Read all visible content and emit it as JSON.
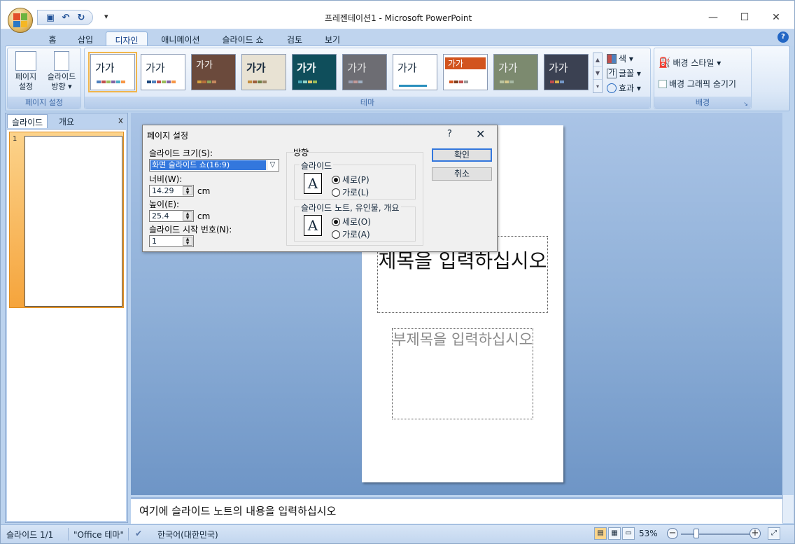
{
  "window": {
    "title": "프레젠테이션1 - Microsoft PowerPoint",
    "minimize": "—",
    "maximize": "☐",
    "close": "✕"
  },
  "ribbon_tabs": [
    "홈",
    "삽입",
    "디자인",
    "애니메이션",
    "슬라이드 쇼",
    "검토",
    "보기"
  ],
  "ribbon": {
    "page_setup": {
      "btn_page_setup": "페이지\n설정",
      "btn_page_setup_l1": "페이지",
      "btn_page_setup_l2": "설정",
      "btn_orient_l1": "슬라이드",
      "btn_orient_l2": "방향 ▾",
      "label": "페이지 설정"
    },
    "themes": {
      "label": "테마",
      "items": [
        "가가",
        "가가",
        "가가",
        "가가",
        "가가",
        "가가",
        "가가",
        "가가",
        "가가",
        "가가"
      ]
    },
    "theme_opts": {
      "colors": "색 ▾",
      "fonts": "글꼴 ▾",
      "effects": "효과 ▾"
    },
    "background": {
      "styles": "배경 스타일 ▾",
      "hide_graphics": "배경 그래픽 숨기기",
      "label": "배경"
    }
  },
  "left_pane": {
    "tab_slides": "슬라이드",
    "tab_outline": "개요",
    "close": "x",
    "slide_number": "1"
  },
  "slide": {
    "title_placeholder": "제목을 입력하십시오",
    "subtitle_placeholder": "부제목을 입력하십시오"
  },
  "notes": {
    "placeholder": "여기에 슬라이드 노트의 내용을 입력하십시오"
  },
  "status": {
    "slide": "슬라이드 1/1",
    "theme": "\"Office 테마\"",
    "language": "한국어(대한민국)",
    "zoom": "53%"
  },
  "dialog": {
    "title": "페이지 설정",
    "help": "?",
    "close": "✕",
    "slide_size_label": "슬라이드 크기(S):",
    "slide_size_value": "화면 슬라이드 쇼(16:9)",
    "width_label": "너비(W):",
    "width_value": "14.29",
    "height_label": "높이(E):",
    "height_value": "25.4",
    "unit": "cm",
    "start_number_label": "슬라이드 시작 번호(N):",
    "start_number_value": "1",
    "orientation_label": "방향",
    "slides_group": "슬라이드",
    "notes_group": "슬라이드 노트, 유인물, 개요",
    "portrait": "세로(P)",
    "landscape": "가로(L)",
    "notes_portrait": "세로(O)",
    "notes_landscape": "가로(A)",
    "ok": "확인",
    "cancel": "취소"
  }
}
